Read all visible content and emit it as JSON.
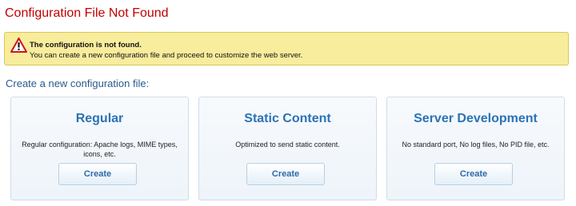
{
  "page": {
    "title": "Configuration File Not Found"
  },
  "notice": {
    "icon": "warning-icon",
    "title": "The configuration is not found.",
    "text": "You can create a new configuration file and proceed to customize the web server.",
    "colors": {
      "background": "#f8ec9d",
      "border": "#d9c653",
      "icon": "#d0141a"
    }
  },
  "section": {
    "heading": "Create a new configuration file:"
  },
  "cards": [
    {
      "title": "Regular",
      "description": "Regular configuration: Apache logs, MIME types, icons, etc.",
      "button_label": "Create"
    },
    {
      "title": "Static Content",
      "description": "Optimized to send static content.",
      "button_label": "Create"
    },
    {
      "title": "Server Development",
      "description": "No standard port, No log files, No PID file, etc.",
      "button_label": "Create"
    }
  ],
  "colors": {
    "title": "#c20000",
    "heading": "#2a5a8c",
    "card_title": "#2b73b5",
    "button_text": "#2c6aa8"
  }
}
